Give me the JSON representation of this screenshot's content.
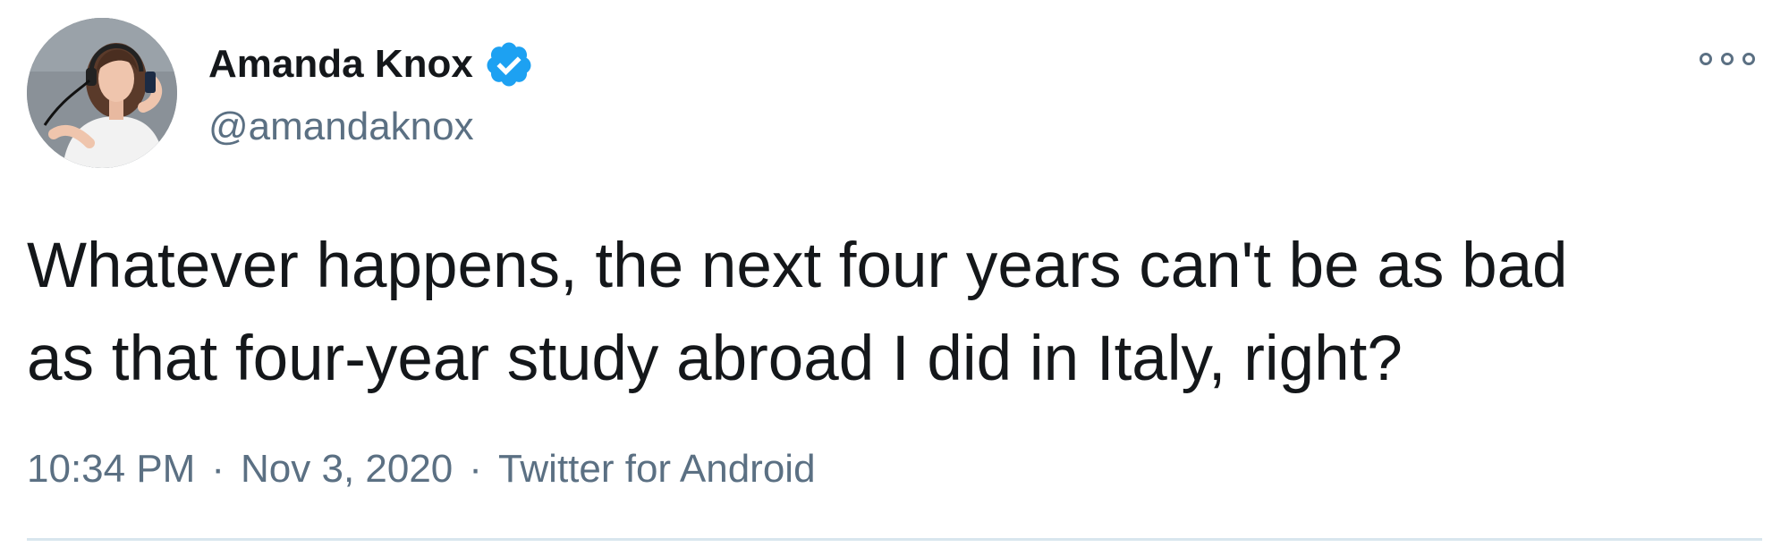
{
  "tweet": {
    "author": {
      "display_name": "Amanda Knox",
      "handle": "@amandaknox",
      "verified": true,
      "avatar_icon": "profile-photo"
    },
    "text": "Whatever happens, the next four years can't be as bad\nas that four-year study abroad I did in Italy, right?",
    "time": "10:34 PM",
    "separator": "·",
    "date": "Nov 3, 2020",
    "source": "Twitter for Android",
    "more_icon": "more-options-icon"
  },
  "colors": {
    "primary_text": "#14171a",
    "secondary_text": "#5b7083",
    "verified_blue": "#1da1f2",
    "divider": "#d8e6ee"
  }
}
